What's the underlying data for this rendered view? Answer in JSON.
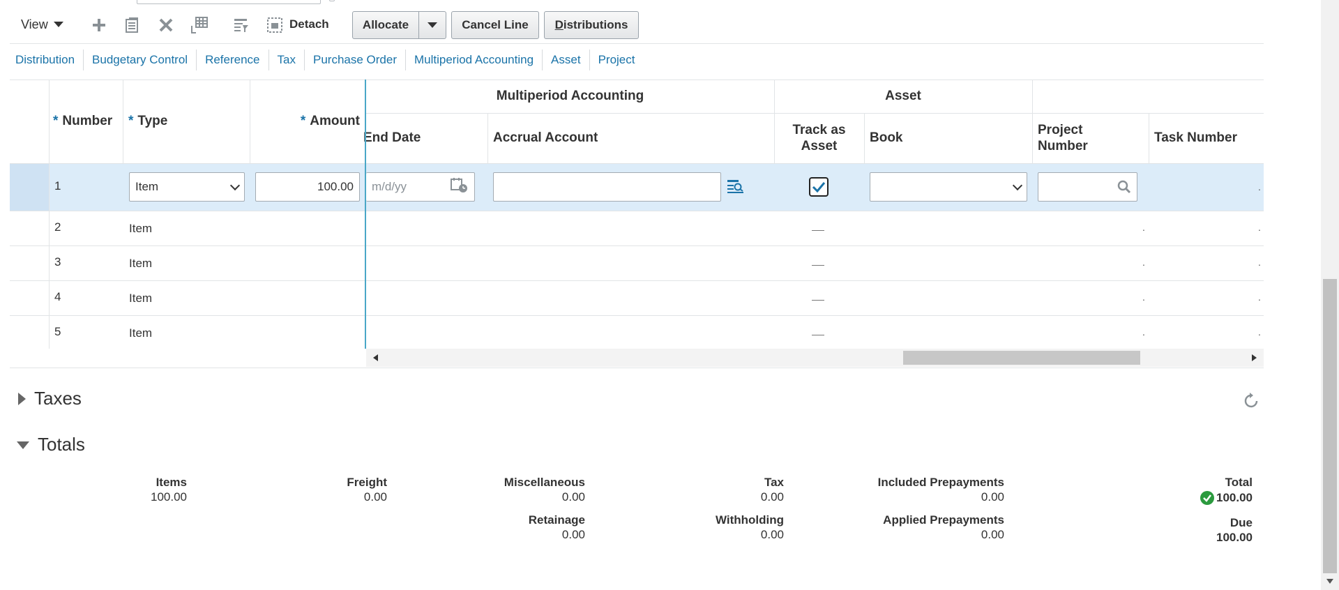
{
  "toolbar": {
    "view_label": "View",
    "detach_label": "Detach",
    "allocate_label": "Allocate",
    "cancel_line_label": "Cancel Line",
    "distributions_label": "Distributions",
    "icons": [
      "add-icon",
      "duplicate-icon",
      "delete-icon",
      "split-icon",
      "query-by-example-icon",
      "detach-icon"
    ]
  },
  "tabs": [
    "Distribution",
    "Budgetary Control",
    "Reference",
    "Tax",
    "Purchase Order",
    "Multiperiod Accounting",
    "Asset",
    "Project"
  ],
  "table": {
    "group_headers": {
      "multiperiod": "Multiperiod Accounting",
      "asset": "Asset"
    },
    "columns": {
      "number": "Number",
      "type": "Type",
      "amount": "Amount",
      "end_date": "End Date",
      "accrual_account": "Accrual Account",
      "track_as_asset_1": "Track as",
      "track_as_asset_2": "Asset",
      "book": "Book",
      "project_number_1": "Project",
      "project_number_2": "Number",
      "task_number": "Task Number"
    },
    "required_mark": "*",
    "selected_row": {
      "number": "1",
      "type": "Item",
      "amount": "100.00",
      "end_date_placeholder": "m/d/yy",
      "accrual_account": "",
      "track_as_asset": true,
      "book": "",
      "project_number": ""
    },
    "rows": [
      {
        "number": "2",
        "type": "Item"
      },
      {
        "number": "3",
        "type": "Item"
      },
      {
        "number": "4",
        "type": "Item"
      },
      {
        "number": "5",
        "type": "Item"
      }
    ],
    "truncated_mark": "."
  },
  "sections": {
    "taxes": "Taxes",
    "totals": "Totals"
  },
  "totals": {
    "items": {
      "label": "Items",
      "value": "100.00"
    },
    "freight": {
      "label": "Freight",
      "value": "0.00"
    },
    "miscellaneous": {
      "label": "Miscellaneous",
      "value": "0.00"
    },
    "tax": {
      "label": "Tax",
      "value": "0.00"
    },
    "included_prepayments": {
      "label": "Included Prepayments",
      "value": "0.00"
    },
    "total": {
      "label": "Total",
      "value": "100.00"
    },
    "retainage": {
      "label": "Retainage",
      "value": "0.00"
    },
    "withholding": {
      "label": "Withholding",
      "value": "0.00"
    },
    "applied_prepayments": {
      "label": "Applied Prepayments",
      "value": "0.00"
    },
    "due": {
      "label": "Due",
      "value": "100.00"
    }
  },
  "colors": {
    "link": "#1a73a8",
    "selected_row": "#dcecf9",
    "success": "#2b9a3e",
    "freeze_line": "#4aa7c7"
  }
}
